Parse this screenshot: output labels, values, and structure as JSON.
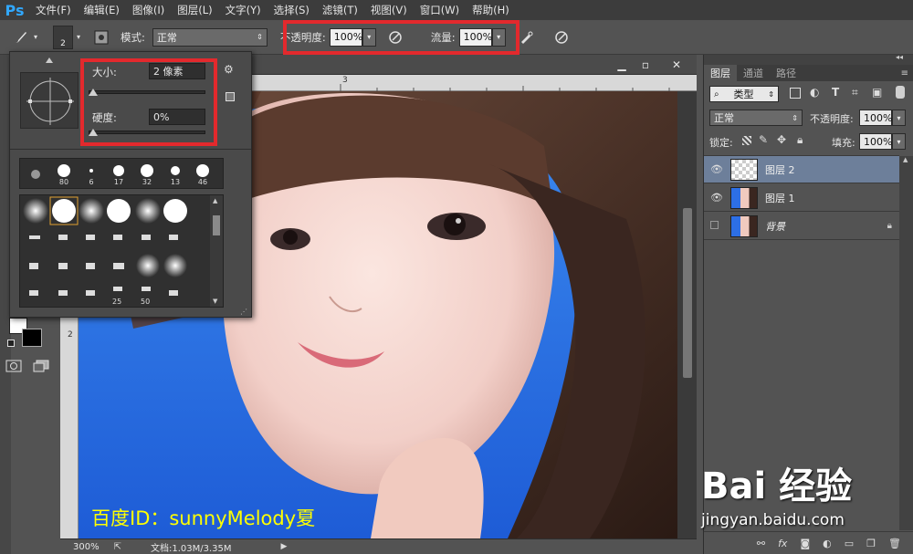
{
  "app": {
    "logo": "Ps"
  },
  "menu": [
    "文件(F)",
    "编辑(E)",
    "图像(I)",
    "图层(L)",
    "文字(Y)",
    "选择(S)",
    "滤镜(T)",
    "视图(V)",
    "窗口(W)",
    "帮助(H)"
  ],
  "options": {
    "brush_size_value": "2",
    "mode_label": "模式:",
    "mode_value": "正常",
    "opacity_label": "不透明度:",
    "opacity_value": "100%",
    "flow_label": "流量:",
    "flow_value": "100%"
  },
  "brush_popup": {
    "size_label": "大小:",
    "size_value": "2 像素",
    "hardness_label": "硬度:",
    "hardness_value": "0%",
    "size_fraction": 0.0,
    "hardness_fraction": 0.0,
    "preset_row_numbers": [
      "",
      "80",
      "6",
      "17",
      "32",
      "13",
      "46"
    ],
    "grid_numbers": [
      "25",
      "50"
    ]
  },
  "document": {
    "ruler_top_marks": [
      "3"
    ],
    "ruler_left_marks": [
      "2"
    ],
    "zoom": "300%",
    "doc_info": "文档:1.03M/3.35M"
  },
  "layers_panel": {
    "tabs": [
      "图层",
      "通道",
      "路径"
    ],
    "filter_kind": "类型",
    "blend_mode": "正常",
    "opacity_label": "不透明度:",
    "opacity_value": "100%",
    "lock_label": "锁定:",
    "fill_label": "填充:",
    "fill_value": "100%",
    "layers": [
      {
        "name": "图层 2",
        "selected": true,
        "visible": true,
        "kind": "transparent"
      },
      {
        "name": "图层 1",
        "selected": false,
        "visible": true,
        "kind": "photo"
      },
      {
        "name": "背景",
        "selected": false,
        "visible": false,
        "kind": "photo",
        "locked": true
      }
    ]
  },
  "watermark": {
    "author": "百度ID：sunnyMelody夏",
    "brand": "Bai 经验",
    "url": "jingyan.baidu.com"
  },
  "colors": {
    "highlight": "#e3292d",
    "selected_layer": "#6d7f9a",
    "watermark_text": "#ffff00"
  }
}
